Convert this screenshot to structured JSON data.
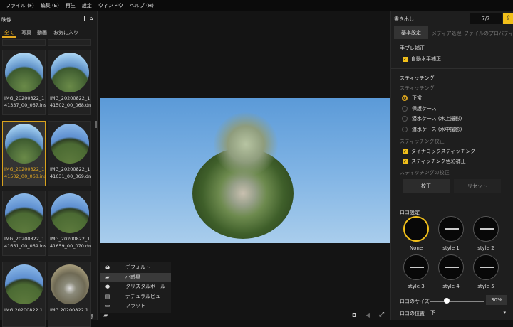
{
  "menu": [
    "ファイル (F)",
    "編集 (E)",
    "再生",
    "設定",
    "ウィンドウ",
    "ヘルプ (H)"
  ],
  "library": {
    "title": "映像",
    "tabs": [
      "全て",
      "写真",
      "動画",
      "お気に入り"
    ],
    "active_tab": 0,
    "items": [
      {
        "l1": "IMG_20200822_1",
        "l2": "41337_00_067.ins",
        "style": "",
        "selected": false
      },
      {
        "l1": "IMG_20200822_1",
        "l2": "41502_00_068.dn",
        "style": "",
        "selected": false
      },
      {
        "l1": "IMG_20200822_1",
        "l2": "41502_00_068.ins",
        "style": "",
        "selected": true
      },
      {
        "l1": "IMG_20200822_1",
        "l2": "41631_00_069.dn",
        "style": "g",
        "selected": false
      },
      {
        "l1": "IMG_20200822_1",
        "l2": "41631_00_069.ins",
        "style": "g",
        "selected": false
      },
      {
        "l1": "IMG_20200822_1",
        "l2": "41659_00_070.dn",
        "style": "g",
        "selected": false
      },
      {
        "l1": "IMG 20200822 1",
        "l2": "",
        "style": "g",
        "selected": false
      },
      {
        "l1": "IMG 20200822 1",
        "l2": "",
        "style": "r",
        "selected": false
      }
    ]
  },
  "viewmenu": {
    "items": [
      {
        "icon": "◕",
        "label": "デフォルト"
      },
      {
        "icon": "▰",
        "label": "小惑星"
      },
      {
        "icon": "●",
        "label": "クリスタルボール"
      },
      {
        "icon": "▤",
        "label": "ナチュラルビュー"
      },
      {
        "icon": "▭",
        "label": "フラット"
      }
    ],
    "active": 1
  },
  "export": {
    "title": "書き出し",
    "count": "7/7"
  },
  "tabs": [
    "基本設定",
    "メディア処理",
    "ファイルのプロパティ"
  ],
  "stab": {
    "title": "手ブレ補正",
    "auto_level": "自動水平補正"
  },
  "stitch": {
    "title": "スティッチング",
    "sub": "スティッチング",
    "options": [
      "正常",
      "保護ケース",
      "潜水ケース (水上撮影)",
      "潜水ケース (水中撮影)"
    ],
    "selected": 0,
    "calib_title": "スティッチング校正",
    "dynamic": "ダイナミックスティッチング",
    "color": "スティッチング色彩補正",
    "calib2": "スティッチングの校正",
    "calib_btn": "校正",
    "reset_btn": "リセット"
  },
  "logo": {
    "title": "ロゴ設定",
    "styles": [
      "None",
      "style 1",
      "style 2",
      "style 3",
      "style 4",
      "style 5"
    ],
    "selected": 0,
    "size_label": "ロゴのサイズ",
    "size_value": "30%",
    "size_fraction": 0.3,
    "pos_label": "ロゴの位置",
    "pos_value": "下"
  },
  "accent": "#f2c01a"
}
